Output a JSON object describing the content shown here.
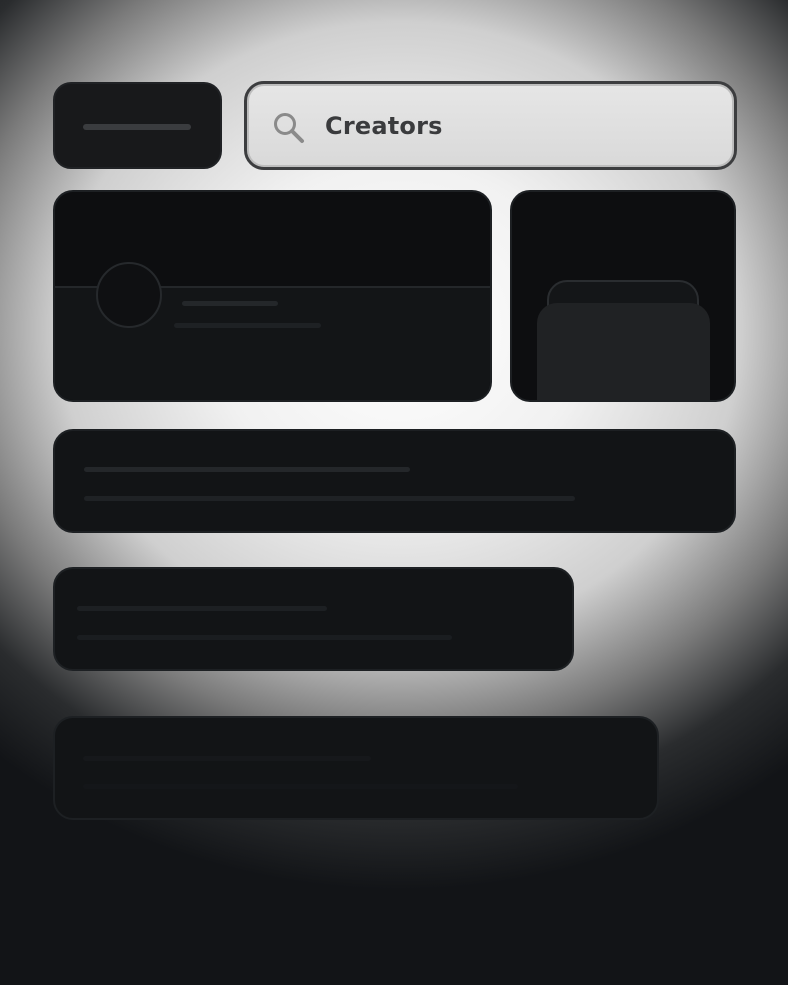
{
  "search": {
    "value": "Creators",
    "icon": "search-icon"
  },
  "colors": {
    "card": "#121416",
    "search_field": "#e0e0e0",
    "search_text": "#3a3b3d"
  }
}
